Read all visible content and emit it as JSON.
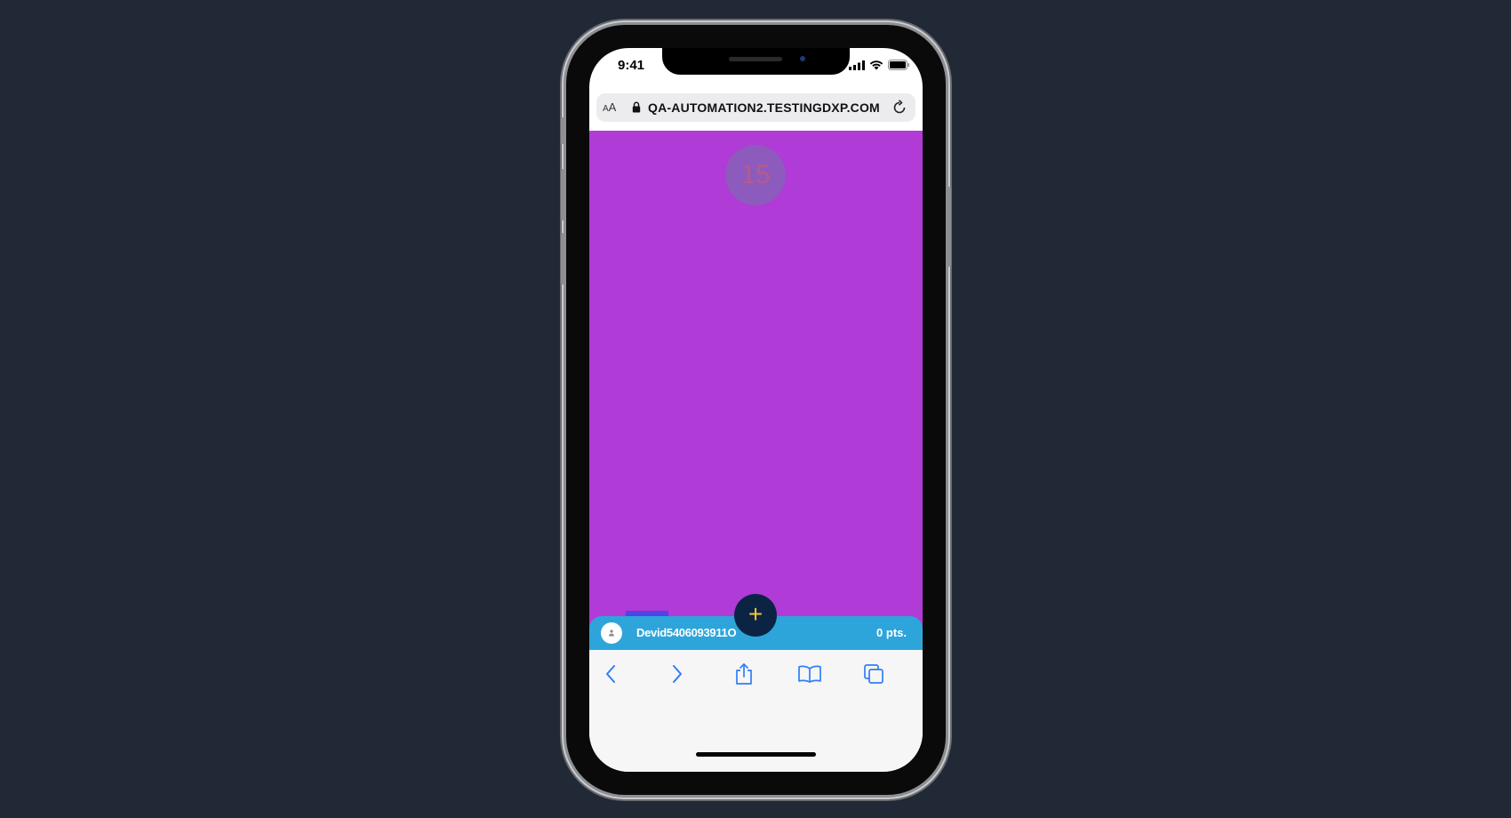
{
  "status_bar": {
    "time": "9:41"
  },
  "browser": {
    "text_size_label_small": "A",
    "text_size_label_large": "A",
    "url": "QA-AUTOMATION2.TESTINGDXP.COM",
    "toolbar_icons": [
      "back-icon",
      "forward-icon",
      "share-icon",
      "bookmarks-icon",
      "tabs-icon"
    ]
  },
  "game": {
    "timer_value": "15",
    "add_button_label": "+",
    "background_color": "#b03bd6"
  },
  "user_bar": {
    "username": "Devid5406093911O",
    "points": "0 pts."
  },
  "colors": {
    "page_background": "#212836",
    "user_bar": "#2ea5da",
    "fab": "#0b2444",
    "fab_plus": "#f5c533",
    "square": "#4f45e6",
    "browser_accent": "#2f7ef6"
  }
}
